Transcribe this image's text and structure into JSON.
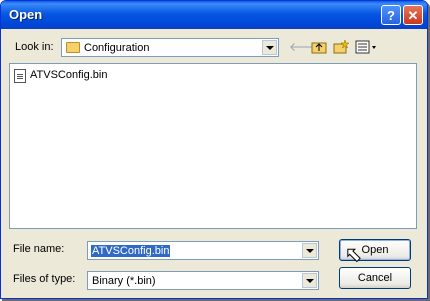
{
  "window": {
    "title": "Open"
  },
  "lookin": {
    "label": "Look in:",
    "value": "Configuration"
  },
  "files": [
    {
      "name": "ATVSConfig.bin"
    }
  ],
  "filename": {
    "label": "File name:",
    "value": "ATVSConfig.bin"
  },
  "filetype": {
    "label": "Files of type:",
    "value": "Binary (*.bin)"
  },
  "buttons": {
    "open": "Open",
    "cancel": "Cancel"
  },
  "icons": {
    "back": "back-arrow-icon",
    "up": "up-folder-icon",
    "new_folder": "new-folder-icon",
    "view": "view-menu-icon"
  }
}
